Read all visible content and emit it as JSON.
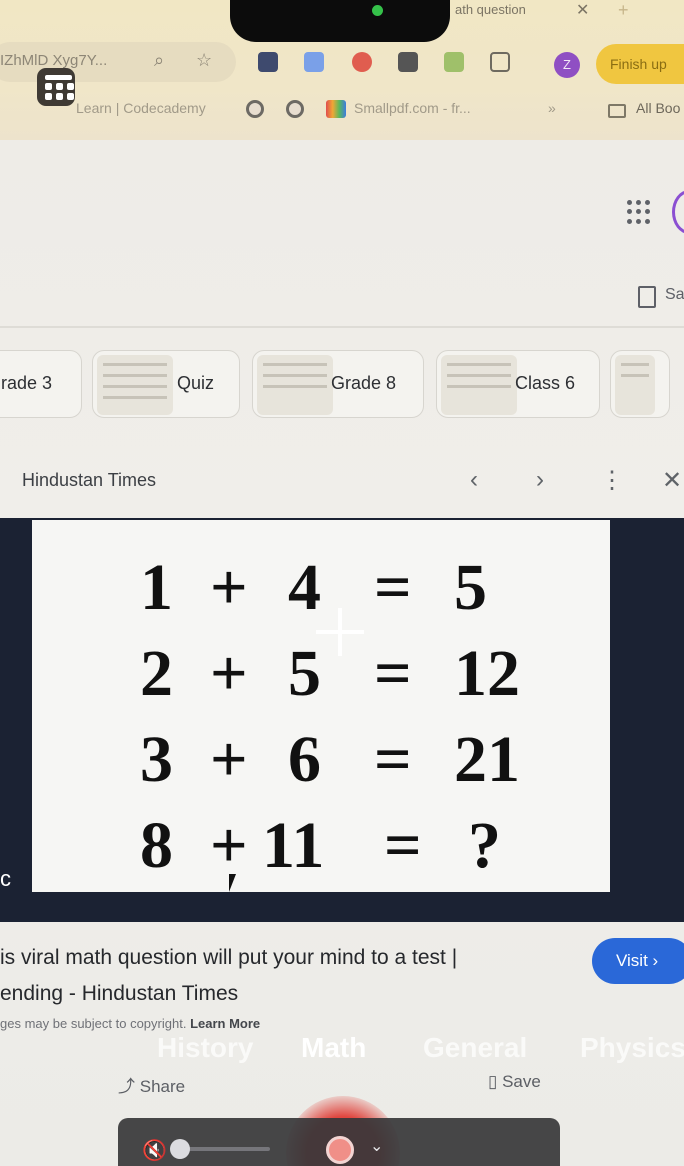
{
  "browser": {
    "tab_title": "ath question",
    "url_fragment": "IZhMlD Xyg7Y...",
    "finish_button": "Finish up",
    "profile_initial": "Z",
    "bookmarks": [
      {
        "label": "Learn | Codecademy"
      },
      {
        "label": "Smallpdf.com - fr..."
      },
      {
        "label": "All Boo"
      }
    ],
    "more_bookmarks": "»"
  },
  "header": {
    "save_label": "Sa"
  },
  "chips": [
    {
      "label": "rade 3"
    },
    {
      "label": "Quiz"
    },
    {
      "label": "Grade 8"
    },
    {
      "label": "Class 6"
    }
  ],
  "viewer": {
    "source": "Hindustan Times",
    "prev_icon": "‹",
    "next_icon": "›",
    "more_icon": "⋮",
    "close_icon": "✕"
  },
  "puzzle": {
    "rows": [
      {
        "a": "1",
        "op": "+",
        "b": "4",
        "eq": "=",
        "r": "5"
      },
      {
        "a": "2",
        "op": "+",
        "b": "5",
        "eq": "=",
        "r": "12"
      },
      {
        "a": "3",
        "op": "+",
        "b": "6",
        "eq": "=",
        "r": "21"
      },
      {
        "a": "8",
        "op": "+",
        "b": "11",
        "eq": "=",
        "r": "?"
      }
    ]
  },
  "result": {
    "caption_line1": "is viral math question will put your mind to a test |",
    "caption_line2": "ending - Hindustan Times",
    "visit_label": "Visit ›",
    "copyright_text": "ges may be subject to copyright.",
    "learn_more": "Learn More",
    "share_label": "Share",
    "save_label": "Save"
  },
  "mode_tabs": [
    {
      "label": "History",
      "active": false
    },
    {
      "label": "Math",
      "active": true
    },
    {
      "label": "General",
      "active": false
    },
    {
      "label": "Physics",
      "active": false
    }
  ],
  "colors": {
    "chrome_bg": "#f1e7c4",
    "finish_button": "#f0c640",
    "visit_button": "#2a68d8",
    "image_frame": "#1b2233",
    "record": "#e0463f"
  }
}
